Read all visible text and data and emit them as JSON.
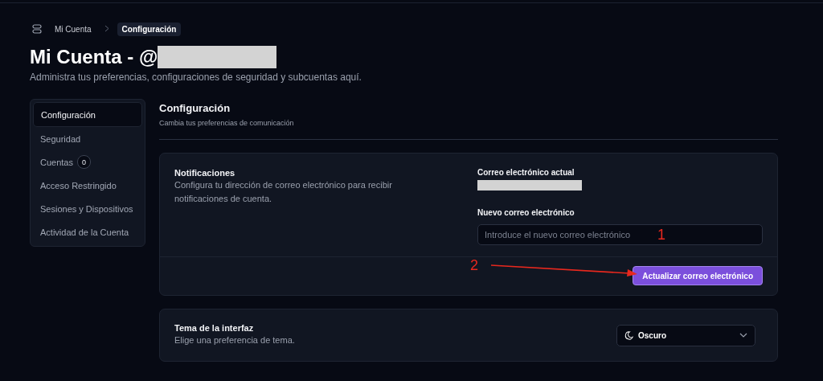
{
  "breadcrumb": {
    "items": [
      {
        "label": "Mi Cuenta",
        "selected": false
      },
      {
        "label": "Configuración",
        "selected": true
      }
    ]
  },
  "header": {
    "title": "Mi Cuenta - @",
    "username_redacted": true,
    "subtitle": "Administra tus preferencias, configuraciones de seguridad y subcuentas aquí."
  },
  "sidebar": {
    "items": [
      {
        "label": "Configuración",
        "selected": true
      },
      {
        "label": "Seguridad",
        "selected": false
      },
      {
        "label": "Cuentas",
        "selected": false,
        "badge": "0"
      },
      {
        "label": "Acceso Restringido",
        "selected": false
      },
      {
        "label": "Sesiones y Dispositivos",
        "selected": false
      },
      {
        "label": "Actividad de la Cuenta",
        "selected": false
      }
    ]
  },
  "section": {
    "title": "Configuración",
    "subtitle": "Cambia tus preferencias de comunicación"
  },
  "notifications": {
    "title": "Notificaciones",
    "description": "Configura tu dirección de correo electrónico para recibir notificaciones de cuenta.",
    "current_label": "Correo electrónico actual",
    "current_email_redacted": true,
    "new_label": "Nuevo correo electrónico",
    "new_placeholder": "Introduce el nuevo correo electrónico",
    "button": "Actualizar correo electrónico"
  },
  "annotations": [
    {
      "label": "1"
    },
    {
      "label": "2"
    }
  ],
  "theme": {
    "title": "Tema de la interfaz",
    "description": "Elige una preferencia de tema.",
    "value": "Oscuro"
  }
}
